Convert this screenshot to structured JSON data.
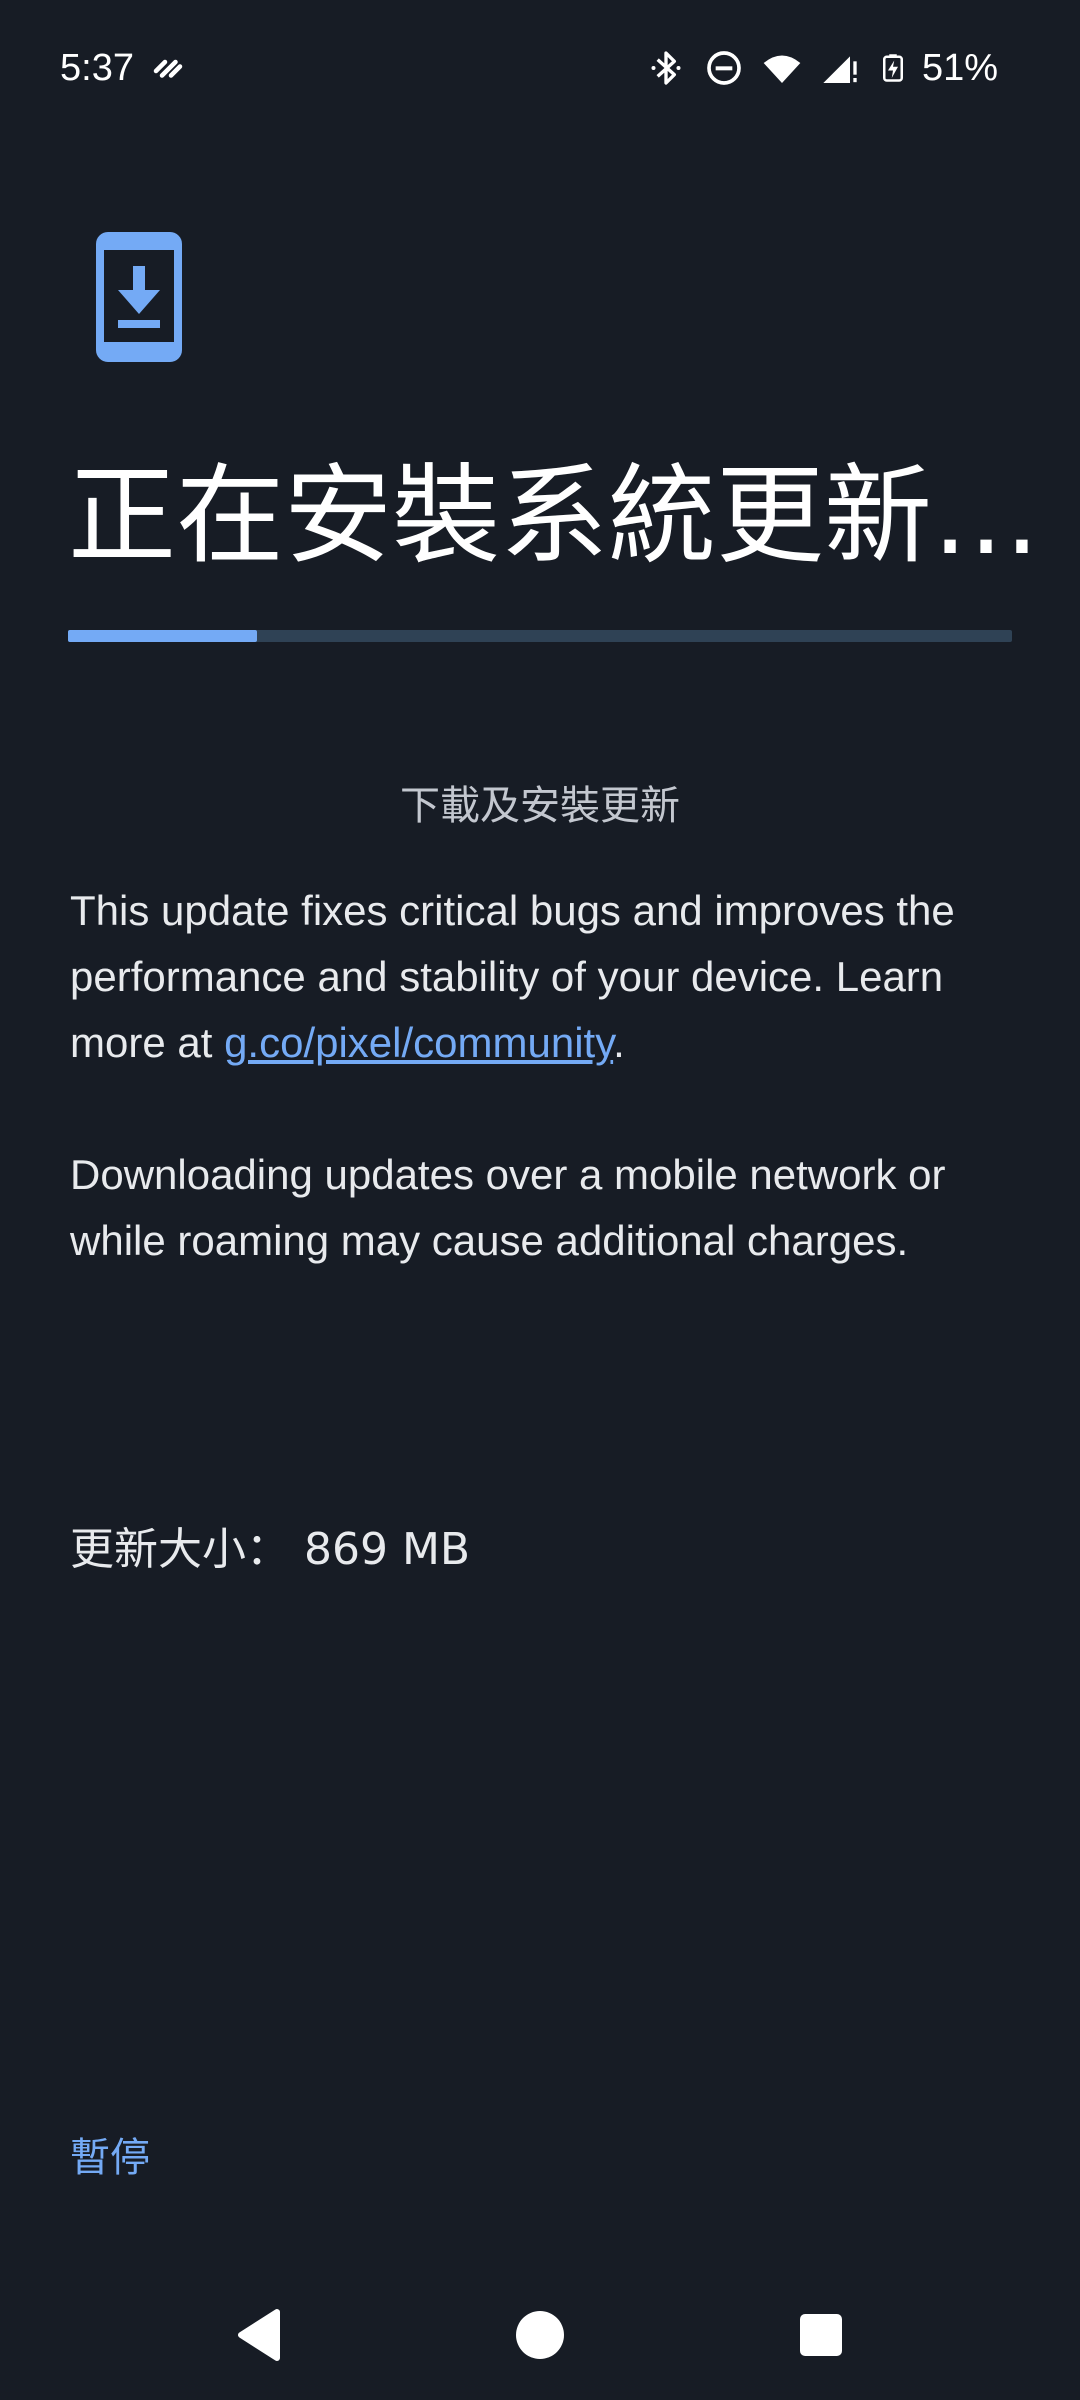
{
  "status_bar": {
    "time": "5:37",
    "battery_percent": "51%",
    "icons": [
      "signal-check-icon",
      "bluetooth-icon",
      "do-not-disturb-icon",
      "wifi-icon",
      "cellular-signal-icon",
      "battery-charging-icon"
    ]
  },
  "update": {
    "icon": "phone-download-icon",
    "title": "正在安裝系統更新…",
    "progress": 0.2,
    "subtitle": "下載及安裝更新",
    "description_prefix": "This update fixes critical bugs and improves the performance and stability of your device. Learn more at ",
    "link_text": "g.co/pixel/community",
    "description_suffix": ".",
    "roaming_notice": "Downloading updates over a mobile network or while roaming may cause additional charges.",
    "size_label": "更新大小：",
    "size_value": "869 MB",
    "pause_label": "暫停"
  },
  "nav_bar": {
    "buttons": [
      "back-icon",
      "home-icon",
      "recents-icon"
    ]
  },
  "colors": {
    "background": "#171c25",
    "accent": "#74aaf5",
    "progress_track": "#2f4255"
  }
}
